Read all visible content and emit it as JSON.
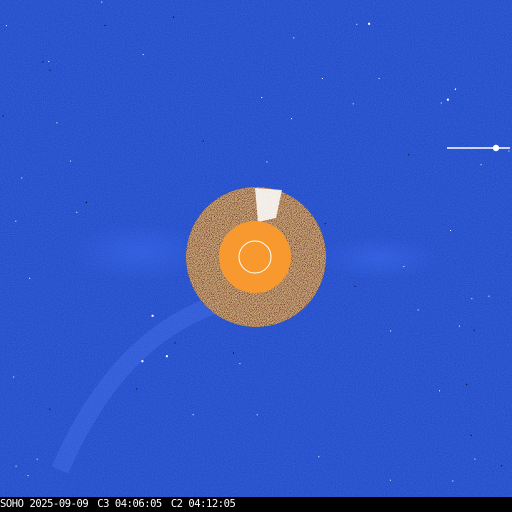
{
  "image": {
    "subject": "LASCO coronagraph composite",
    "background_color": "#1f49c9",
    "occulter_color": "#f7992e",
    "sun_limb_color": "#ffffff",
    "inner_ring_noise_colors": [
      "#ffffff",
      "#4a2c20",
      "#8a6048",
      "#d8c6b4",
      "#2a160f"
    ]
  },
  "caption": {
    "observatory": "SOHO",
    "date": "2025-09-09",
    "c3_time": "C3 04:06:05",
    "c2_time": "C2 04:12:05"
  }
}
